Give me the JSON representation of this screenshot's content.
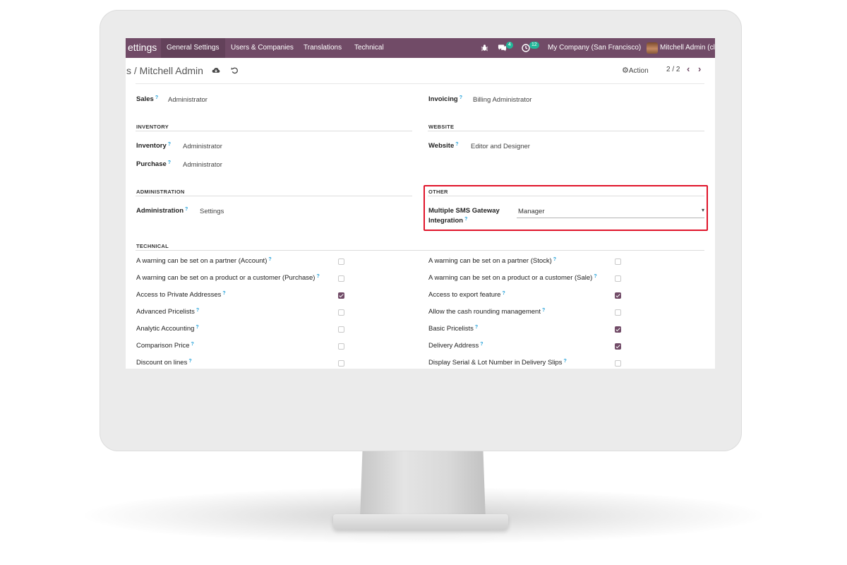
{
  "navbar": {
    "app_title": "ettings",
    "menus": [
      "General Settings",
      "Users & Companies",
      "Translations",
      "Technical"
    ],
    "messages_count": "4",
    "activities_count": "12",
    "company": "My Company (San Francisco)",
    "user": "Mitchell Admin (cl"
  },
  "control": {
    "breadcrumb": "s / Mitchell Admin",
    "action_label": "Action",
    "pager": "2 / 2"
  },
  "fields": {
    "sales_label": "Sales",
    "sales_value": "Administrator",
    "invoicing_label": "Invoicing",
    "invoicing_value": "Billing Administrator",
    "inventory_section": "INVENTORY",
    "website_section": "WEBSITE",
    "inventory_label": "Inventory",
    "inventory_value": "Administrator",
    "website_label": "Website",
    "website_value": "Editor and Designer",
    "purchase_label": "Purchase",
    "purchase_value": "Administrator",
    "administration_section": "ADMINISTRATION",
    "other_section": "OTHER",
    "administration_label": "Administration",
    "administration_value": "Settings",
    "sms_label_line1": "Multiple SMS Gateway",
    "sms_label_line2": "Integration",
    "sms_value": "Manager",
    "help_mark": "?"
  },
  "technical": {
    "section": "TECHNICAL",
    "left": [
      {
        "label": "A warning can be set on a partner (Account)",
        "checked": false
      },
      {
        "label": "A warning can be set on a product or a customer (Purchase)",
        "checked": false
      },
      {
        "label": "Access to Private Addresses",
        "checked": true
      },
      {
        "label": "Advanced Pricelists",
        "checked": false
      },
      {
        "label": "Analytic Accounting",
        "checked": false
      },
      {
        "label": "Comparison Price",
        "checked": false
      },
      {
        "label": "Discount on lines",
        "checked": false
      }
    ],
    "right": [
      {
        "label": "A warning can be set on a partner (Stock)",
        "checked": false
      },
      {
        "label": "A warning can be set on a product or a customer (Sale)",
        "checked": false
      },
      {
        "label": "Access to export feature",
        "checked": true
      },
      {
        "label": "Allow the cash rounding management",
        "checked": false
      },
      {
        "label": "Basic Pricelists",
        "checked": true
      },
      {
        "label": "Delivery Address",
        "checked": true
      },
      {
        "label": "Display Serial & Lot Number in Delivery Slips",
        "checked": false
      }
    ]
  },
  "colors": {
    "brand": "#714b67",
    "highlight": "#e0142a",
    "badge": "#21b799"
  },
  "icons": {
    "bug": "bug-icon",
    "chat": "chat-icon",
    "clock": "clock-icon",
    "save": "cloud-save-icon",
    "discard": "undo-icon",
    "gear": "gear-icon",
    "prev": "chevron-left-icon",
    "next": "chevron-right-icon",
    "caret": "caret-down-icon"
  }
}
